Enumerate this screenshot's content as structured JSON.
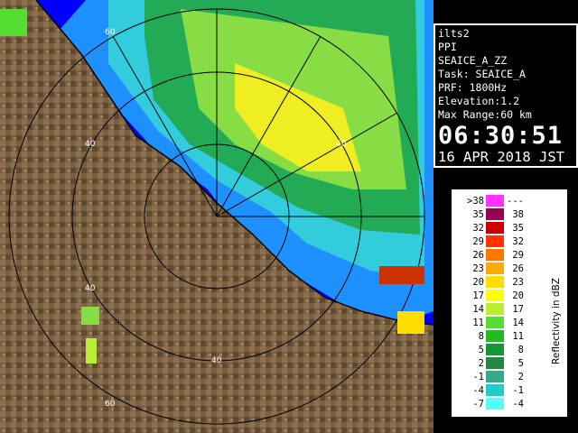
{
  "info": {
    "station": "ilts2",
    "mode": "PPI",
    "product": "SEAICE_A_ZZ",
    "task": "Task: SEAICE_A",
    "prf": "PRF: 1800Hz",
    "elevation": "Elevation:1.2",
    "max_range": "Max Range:60 km",
    "time": "06:30:51",
    "date": "16 APR 2018 JST"
  },
  "legend": {
    "title": "Reflectivity in dBZ",
    "rows": [
      {
        "lo": ">38",
        "hi": "---",
        "color": "#ff33ff"
      },
      {
        "lo": "35",
        "hi": "38",
        "color": "#990055"
      },
      {
        "lo": "32",
        "hi": "35",
        "color": "#cc0000"
      },
      {
        "lo": "29",
        "hi": "32",
        "color": "#ff3300"
      },
      {
        "lo": "26",
        "hi": "29",
        "color": "#ff7700"
      },
      {
        "lo": "23",
        "hi": "26",
        "color": "#ffaa00"
      },
      {
        "lo": "20",
        "hi": "23",
        "color": "#ffdd00"
      },
      {
        "lo": "17",
        "hi": "20",
        "color": "#ffff00"
      },
      {
        "lo": "14",
        "hi": "17",
        "color": "#bbee33"
      },
      {
        "lo": "11",
        "hi": "14",
        "color": "#55dd33"
      },
      {
        "lo": "8",
        "hi": "11",
        "color": "#22bb22"
      },
      {
        "lo": "5",
        "hi": "8",
        "color": "#119933"
      },
      {
        "lo": "2",
        "hi": "5",
        "color": "#228844"
      },
      {
        "lo": "-1",
        "hi": "2",
        "color": "#33aa88"
      },
      {
        "lo": "-4",
        "hi": "-1",
        "color": "#22cccc"
      },
      {
        "lo": "-7",
        "hi": "-4",
        "color": "#55ffff"
      }
    ]
  },
  "radar": {
    "range_labels": [
      "60",
      "40",
      "40",
      "40",
      "40",
      "60"
    ],
    "colors": {
      "sea": "#0000ff",
      "land": "#7a6040",
      "echo_low": "#1e90ff"
    }
  }
}
